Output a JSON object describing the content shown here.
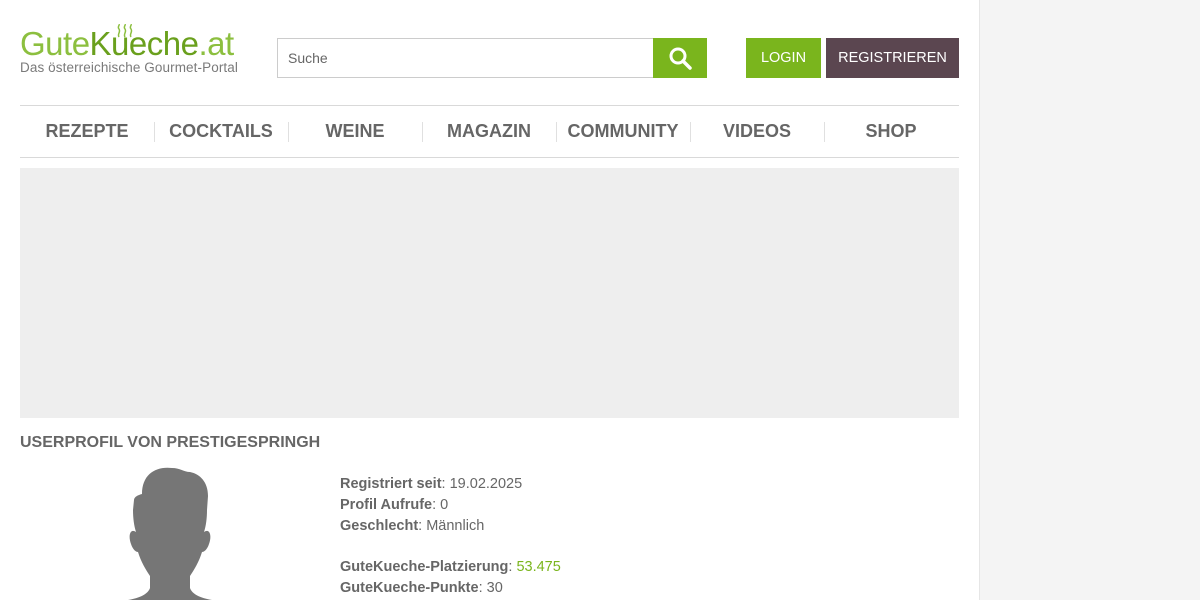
{
  "logo": {
    "gute": "Gute",
    "kueche": "Kueche",
    "at": ".at",
    "subtitle": "Das österreichische Gourmet-Portal"
  },
  "search": {
    "placeholder": "Suche",
    "icon": "search-icon"
  },
  "header": {
    "login_label": "LOGIN",
    "register_label": "REGISTRIEREN"
  },
  "nav": {
    "items": [
      {
        "label": "REZEPTE"
      },
      {
        "label": "COCKTAILS"
      },
      {
        "label": "WEINE"
      },
      {
        "label": "MAGAZIN"
      },
      {
        "label": "COMMUNITY"
      },
      {
        "label": "VIDEOS"
      },
      {
        "label": "SHOP"
      }
    ]
  },
  "profile": {
    "title": "USERPROFIL VON PRESTIGESPRINGH",
    "avatar_icon": "default-male-avatar-icon",
    "registered_label": "Registriert seit",
    "registered_value": ": 19.02.2025",
    "views_label": "Profil Aufrufe",
    "views_value": ": 0",
    "gender_label": "Geschlecht",
    "gender_value": ": Männlich",
    "rank_label": "GuteKueche-Platzierung",
    "rank_sep": ": ",
    "rank_value": "53.475",
    "points_label": "GuteKueche-Punkte",
    "points_value": ": 30"
  },
  "colors": {
    "brand_green": "#7ab51d",
    "register_purple": "#5b4650",
    "text_gray": "#666666",
    "ad_gray": "#eeeeee"
  }
}
